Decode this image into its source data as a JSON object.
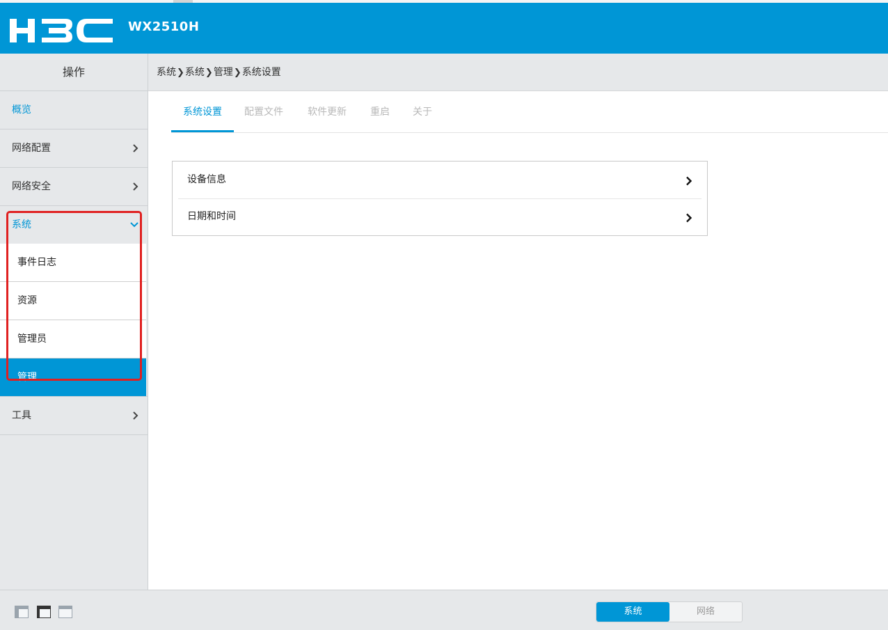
{
  "brand": {
    "logo_text": "H3C",
    "model": "WX2510H",
    "header_color": "#0096d6"
  },
  "sidebar": {
    "title": "操作",
    "items": [
      {
        "label": "概览",
        "chevron": ""
      },
      {
        "label": "网络配置",
        "chevron": "›"
      },
      {
        "label": "网络安全",
        "chevron": "›"
      },
      {
        "label": "系统",
        "chevron": "⌄"
      }
    ],
    "sub_items": [
      {
        "label": "事件日志"
      },
      {
        "label": "资源"
      },
      {
        "label": "管理员"
      },
      {
        "label": "管理"
      }
    ],
    "after_items": [
      {
        "label": "工具",
        "chevron": "›"
      }
    ]
  },
  "breadcrumb": [
    "系统",
    "系统",
    "管理",
    "系统设置"
  ],
  "breadcrumb_separator": "❯",
  "tabs": [
    "系统设置",
    "配置文件",
    "软件更新",
    "重启",
    "关于"
  ],
  "panel": {
    "rows": [
      {
        "label": "设备信息",
        "chevron": "›"
      },
      {
        "label": "日期和时间",
        "chevron": "›"
      }
    ]
  },
  "footer": {
    "switch": [
      "系统",
      "网络"
    ],
    "layout_icons": [
      "layout-sidebar-icon",
      "layout-window-icon",
      "layout-full-icon"
    ]
  }
}
